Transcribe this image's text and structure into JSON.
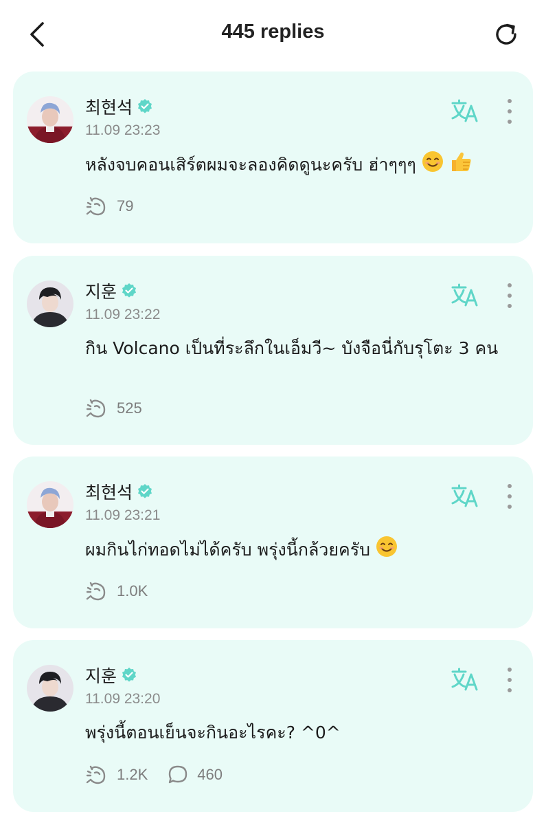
{
  "header": {
    "title": "445 replies",
    "back_icon": "chevron-left-icon",
    "refresh_icon": "refresh-icon"
  },
  "colors": {
    "card_bg": "#e9fbf7",
    "accent": "#5fd6c8",
    "muted": "#8b8b8b"
  },
  "replies": [
    {
      "author": "최현석",
      "verified": true,
      "time": "11.09 23:23",
      "text": "หลังจบคอนเสิร์ตผมจะลองคิดดูนะครับ ฮ่าๆๆๆ",
      "emojis": [
        "smiling-face-emoji",
        "thumbs-up-emoji"
      ],
      "likes": "79",
      "comments": null
    },
    {
      "author": "지훈",
      "verified": true,
      "time": "11.09 23:22",
      "text": "กิน Volcano เป็นที่ระลึกในเอ็มวี~ บังจือนี่กับรุโตะ 3 คน",
      "emojis": [],
      "likes": "525",
      "comments": null
    },
    {
      "author": "최현석",
      "verified": true,
      "time": "11.09 23:21",
      "text": "ผมกินไก่ทอดไม่ได้ครับ พรุ่งนี้กล้วยครับ",
      "emojis": [
        "smiling-face-emoji"
      ],
      "likes": "1.0K",
      "comments": null
    },
    {
      "author": "지훈",
      "verified": true,
      "time": "11.09 23:20",
      "text": "พรุ่งนี้ตอนเย็นจะกินอะไรคะ? ^0^",
      "emojis": [],
      "likes": "1.2K",
      "comments": "460"
    }
  ]
}
